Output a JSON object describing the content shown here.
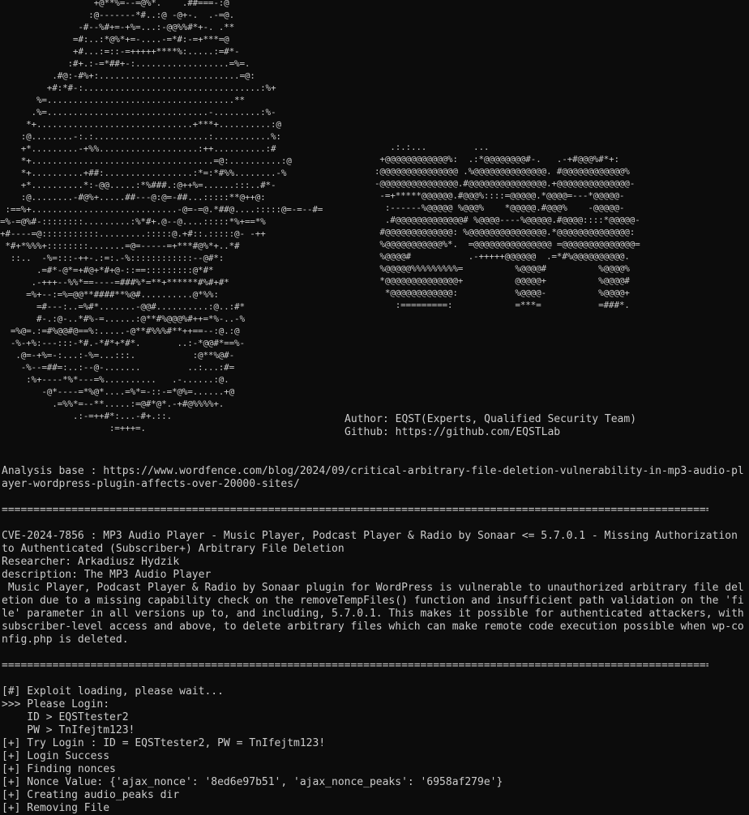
{
  "banner": {
    "art_left": "                  +@**%=--=@%*.    .##===-:@\n                 :@-------*#..:@ -@+-.  .-=@.\n               -#--%#+=-+%=...:-@@%%#*+-. .**\n              =#:..:*@%*+=-....-=*#:-=+***=@\n              +#...:=::-=+++++****%:.....:=#*-\n             :#+.:-=*##+-:..................=%=.\n          .#@:-#%+:...........................=@:\n         +#:*#-:..................................:%+\n       %=....................................**\n      .%=...............................-.........:%-\n     *+..............................+***+..........:@\n    :@........-:.:......................:...........%:\n    +*.........-+%%...................:++..........:#\n    *+...................................=@:..........:@\n    *+..........+##:.................:*=:*#%%........-%\n    +*..........*:-@@.....:*%###.:@++%=......:::..#*-\n    :@........-#@%+.....##---@:@=-##...:::::**@++@:\n :==%+............................-@=-=@.*##@....:::::@=-=--#=\n=%-=@%#-::::::::.........:%*#+.@--@....:::::*%+==*%\n+#----=@:::::::::::.........:::::@.+#::.:::::@- -++\n *#+*%%%+::::::::.......=@=-----=+***#@%*+..*#\n  ::..  -%=:::-++-.:=:.-%::::::::::::--@#*:\n       .=#*-@*=+#@+*#+@-::==:::::::::@*#*\n      .-+++--%%*==----=###%*=**+******#%#+#*\n     =%+--:=%=@@**####**%@#..........@*%%:\n       =#---:..=%#*.......-@@#..........:@..:#*\n       #-.:@-..*#%-=......:@**#%@@@%#++=*%-..-%\n  =%@=.:=#%@@#@==%:.....-@**#%%%#**++==--:@.:@\n  -%-+%:---:::-*#.-*#*+*#*.       ..:-*@@#*==%-\n   .@=-+%=-:...:-%=...:::.           :@**%@#-\n    -%--=##=:..:--@-.......         ..:...:#=\n     :%+----*%*---=%..........   .-......:@.\n        -@*----=*%@*....=%*=-::-=*@%=......+@\n          .=%%*=--**.....:=@#*@*.-+#@%%%%+.\n              .:-=++#*:...-#+.::.\n                     :=+++=.",
    "art_right": "   .:.:...         ...\n +@@@@@@@@@@@@%:  .:*@@@@@@@@#-.   .-+#@@@%#*+:\n:@@@@@@@@@@@@@@@ .%@@@@@@@@@@@@@@. #@@@@@@@@@@@@%\n-@@@@@@@@@@@@@@@.#@@@@@@@@@@@@@@@.+@@@@@@@@@@@@@@-\n -=+*****@@@@@@.#@@@%::::=@@@@@.*@@@@=---*@@@@@-\n  :------%@@@@@ %@@@%    *@@@@@.#@@@%    -@@@@@-\n  .#@@@@@@@@@@@@@# %@@@@----%@@@@@.#@@@@::::*@@@@@-\n #@@@@@@@@@@@@@: %@@@@@@@@@@@@@@@.*@@@@@@@@@@@@@@:\n %@@@@@@@@@@@%*.  =@@@@@@@@@@@@@@@ =@@@@@@@@@@@@@@=\n %@@@@#           .-+++++@@@@@@  .=*#%@@@@@@@@@@.\n %@@@@@%%%%%%%%%=          %@@@@#          %@@@@%\n *@@@@@@@@@@@@@@+          @@@@@+          %@@@@#\n  *@@@@@@@@@@@@:           %@@@@-          %@@@@+\n    :=========:            =***=           =###*.",
    "author": "Author: EQST(Experts, Qualified Security Team)",
    "github": "Github: https://github.com/EQSTLab"
  },
  "analysis_base": "Analysis base : https://www.wordfence.com/blog/2024/09/critical-arbitrary-file-deletion-vulnerability-in-mp3-audio-player-wordpress-plugin-affects-over-20000-sites/",
  "separator": "==================================================================================================================",
  "vuln": {
    "title": "CVE-2024-7856 : MP3 Audio Player - Music Player, Podcast Player & Radio by Sonaar <= 5.7.0.1 - Missing Authorization to Authenticated (Subscriber+) Arbitrary File Deletion",
    "researcher": "Researcher: Arkadiusz Hydzik",
    "description_label": "description: The MP3 Audio Player",
    "description_body": " Music Player, Podcast Player & Radio by Sonaar plugin for WordPress is vulnerable to unauthorized arbitrary file deletion due to a missing capability check on the removeTempFiles() function and insufficient path validation on the 'file' parameter in all versions up to, and including, 5.7.0.1. This makes it possible for authenticated attackers, with subscriber-level access and above, to delete arbitrary files which can make remote code execution possible when wp-config.php is deleted."
  },
  "log": [
    "[#] Exploit loading, please wait...",
    ">>> Please Login:",
    "    ID > EQSTtester2",
    "    PW > TnIfejtm123!",
    "[+] Try Login : ID = EQSTtester2, PW = TnIfejtm123!",
    "[+] Login Success",
    "[+] Finding nonces",
    "[+] Nonce Value: {'ajax_nonce': '8ed6e97b51', 'ajax_nonce_peaks': '6958af279e'}",
    "[+] Creating audio_peaks dir",
    "[+] Removing File"
  ],
  "colors": {
    "background": "#0c0c0c",
    "text": "#cccccc"
  }
}
